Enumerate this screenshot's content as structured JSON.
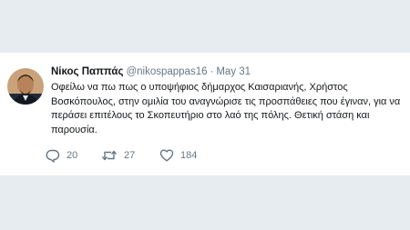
{
  "colors": {
    "background": "#e6ecf0",
    "tweet_background": "#ffffff",
    "text_primary": "#14171a",
    "text_secondary": "#657786"
  },
  "tweet": {
    "author": {
      "display_name": "Νίκος Παππάς",
      "handle": "@nikospappas16"
    },
    "separator": "·",
    "date": "May 31",
    "text": "Οφείλω να πω πως ο υποψήφιος δήμαρχος Καισαριανής, Χρήστος Βοσκόπουλος, στην ομιλία του αναγνώρισε τις προσπάθειες που έγιναν, για να περάσει επιτέλους το Σκοπευτήριο στο λαό της πόλης. Θετική στάση και παρουσία.",
    "actions": {
      "reply": {
        "icon": "reply-icon",
        "count": "20"
      },
      "retweet": {
        "icon": "retweet-icon",
        "count": "27"
      },
      "like": {
        "icon": "heart-icon",
        "count": "184"
      }
    }
  }
}
